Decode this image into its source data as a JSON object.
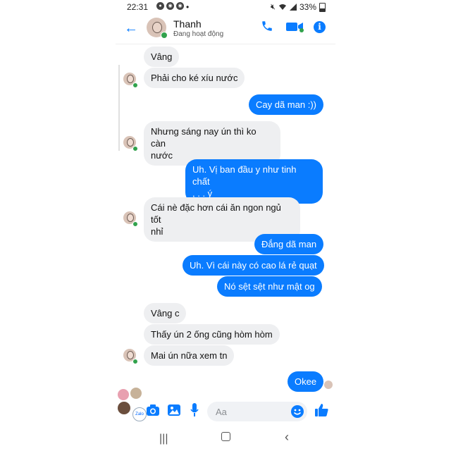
{
  "status_bar": {
    "time": "22:31",
    "battery": "33%"
  },
  "header": {
    "back_icon": "back-arrow-icon",
    "name": "Thanh",
    "status": "Đang hoạt động",
    "accent": "#0a7cff",
    "online_color": "#31a24c"
  },
  "messages": [
    {
      "from": "them",
      "text": "Vâng"
    },
    {
      "from": "them",
      "text": "Phải cho ké xíu nước"
    },
    {
      "from": "me",
      "text": "Cay dã man :))"
    },
    {
      "from": "them",
      "text": "Nhưng sáng nay ún thì ko càn\nnước"
    },
    {
      "from": "me",
      "text": "Uh. Vị ban đầu y như tinh chất\n,      .     . ý"
    },
    {
      "from": "them",
      "text": "Cái nè đặc hơn cái ăn ngon ngủ tốt\nnhỉ"
    },
    {
      "from": "me",
      "text": "Đắng dã man"
    },
    {
      "from": "me",
      "text": "Uh. Vì cái này có cao lá rẻ quạt"
    },
    {
      "from": "me",
      "text": "Nó sệt sệt như mật og"
    },
    {
      "from": "them",
      "text": "Vâng c"
    },
    {
      "from": "them",
      "text": "Thấy ún 2 ống cũng hòm hòm"
    },
    {
      "from": "them",
      "text": "Mai ún nữa xem tn"
    },
    {
      "from": "me",
      "text": "Okee"
    }
  ],
  "composer": {
    "placeholder": "Aa",
    "chat_head_label": "Zalo"
  },
  "colors": {
    "incoming_bubble": "#eeeff1",
    "outgoing_bubble": "#0a7cff"
  }
}
